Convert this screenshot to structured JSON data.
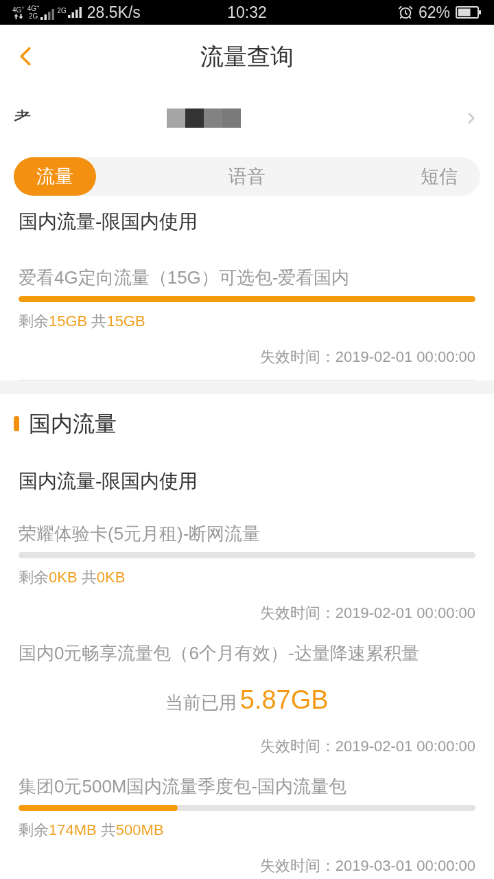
{
  "status_bar": {
    "networks": [
      {
        "kind": "data",
        "label": "4G$^{+}$"
      },
      {
        "kind": "dual",
        "label": "4G$^{+}$",
        "sublabel": "2G"
      },
      {
        "kind": "single",
        "label": "2G"
      }
    ],
    "speed": "28.5K/s",
    "time": "10:32",
    "battery": "62%"
  },
  "header": {
    "title": "流量查询"
  },
  "account": {
    "label": "耂"
  },
  "tabs": [
    {
      "label": "流量",
      "selected": true
    },
    {
      "label": "语音",
      "selected": false
    },
    {
      "label": "短信",
      "selected": false
    }
  ],
  "summary": {
    "title": "国内流量-限国内使用",
    "packages": [
      {
        "kind": "quota",
        "name": "爱看4G定向流量（15G）可选包-爱看国内",
        "level": 1,
        "remaining_label": "剩余",
        "remaining": "15GB",
        "total_label": "共",
        "total": "15GB",
        "expiry": "失效时间：2019-02-01 00:00:00"
      }
    ]
  },
  "section": {
    "heading": "国内流量",
    "title": "国内流量-限国内使用",
    "packages": [
      {
        "kind": "quota",
        "name": "荣耀体验卡(5元月租)-断网流量",
        "level": 0,
        "remaining_label": "剩余",
        "remaining": "0KB",
        "total_label": "共",
        "total": "0KB",
        "expiry": "失效时间：2019-02-01 00:00:00"
      },
      {
        "kind": "usage",
        "name": "国内0元畅享流量包（6个月有效）-达量降速累积量",
        "used_label": "当前已用",
        "used": "5.87GB",
        "expiry": "失效时间：2019-02-01 00:00:00"
      },
      {
        "kind": "quota",
        "name": "集团0元500M国内流量季度包-国内流量包",
        "level": 0.348,
        "remaining_label": "剩余",
        "remaining": "174MB",
        "total_label": "共",
        "total": "500MB",
        "expiry": "失效时间：2019-03-01 00:00:00"
      }
    ]
  }
}
